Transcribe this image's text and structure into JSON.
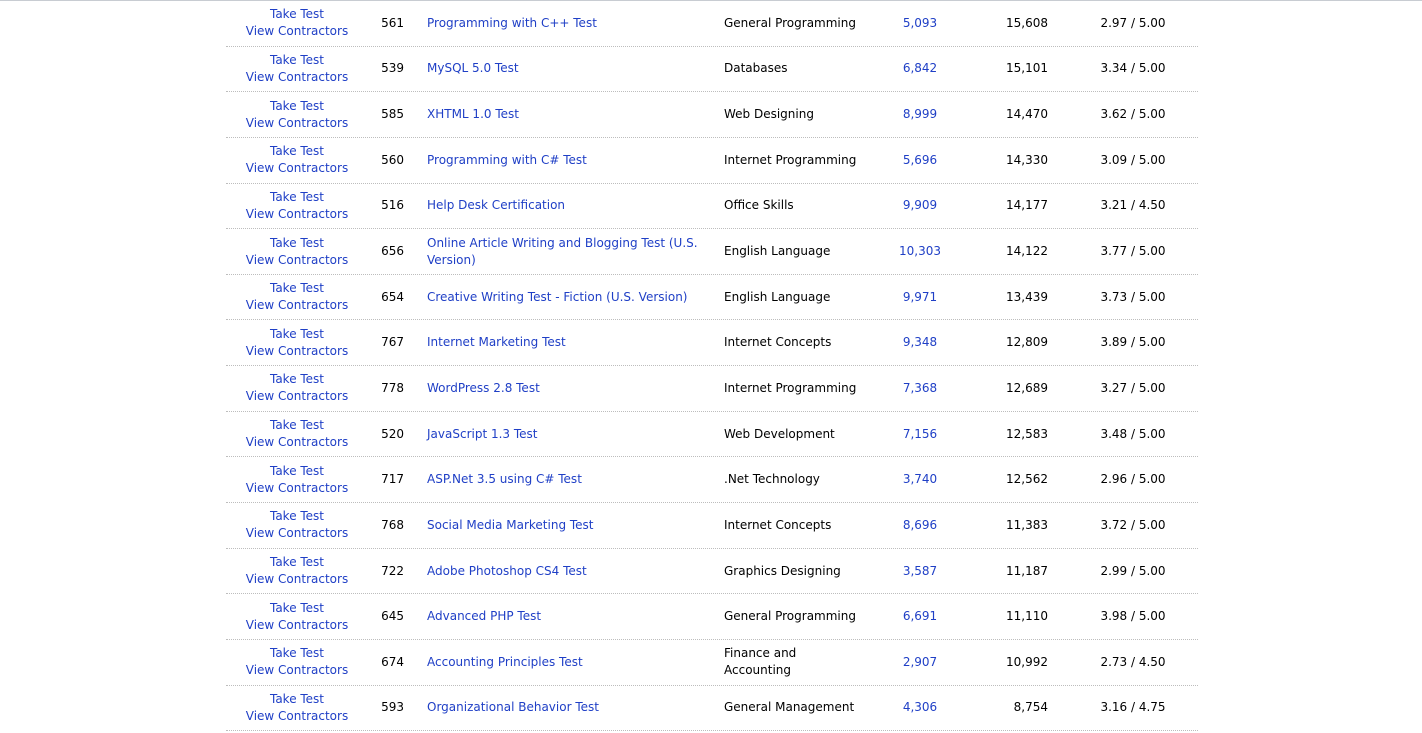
{
  "rows": [
    {
      "take_test": "Take Test",
      "view_contractors": "View Contractors",
      "id": "561",
      "name": "Programming with C++ Test",
      "category": "General Programming",
      "taken": "5,093",
      "passed": "15,608",
      "score": "2.97 / 5.00"
    },
    {
      "take_test": "Take Test",
      "view_contractors": "View Contractors",
      "id": "539",
      "name": "MySQL 5.0 Test",
      "category": "Databases",
      "taken": "6,842",
      "passed": "15,101",
      "score": "3.34 / 5.00"
    },
    {
      "take_test": "Take Test",
      "view_contractors": "View Contractors",
      "id": "585",
      "name": "XHTML 1.0 Test",
      "category": "Web Designing",
      "taken": "8,999",
      "passed": "14,470",
      "score": "3.62 / 5.00"
    },
    {
      "take_test": "Take Test",
      "view_contractors": "View Contractors",
      "id": "560",
      "name": "Programming with C# Test",
      "category": "Internet Programming",
      "taken": "5,696",
      "passed": "14,330",
      "score": "3.09 / 5.00"
    },
    {
      "take_test": "Take Test",
      "view_contractors": "View Contractors",
      "id": "516",
      "name": "Help Desk Certification",
      "category": "Office Skills",
      "taken": "9,909",
      "passed": "14,177",
      "score": "3.21 / 4.50"
    },
    {
      "take_test": "Take Test",
      "view_contractors": "View Contractors",
      "id": "656",
      "name": "Online Article Writing and Blogging Test (U.S. Version)",
      "category": "English Language",
      "taken": "10,303",
      "passed": "14,122",
      "score": "3.77 / 5.00"
    },
    {
      "take_test": "Take Test",
      "view_contractors": "View Contractors",
      "id": "654",
      "name": "Creative Writing Test - Fiction (U.S. Version)",
      "category": "English Language",
      "taken": "9,971",
      "passed": "13,439",
      "score": "3.73 / 5.00"
    },
    {
      "take_test": "Take Test",
      "view_contractors": "View Contractors",
      "id": "767",
      "name": "Internet Marketing Test",
      "category": "Internet Concepts",
      "taken": "9,348",
      "passed": "12,809",
      "score": "3.89 / 5.00"
    },
    {
      "take_test": "Take Test",
      "view_contractors": "View Contractors",
      "id": "778",
      "name": "WordPress 2.8 Test",
      "category": "Internet Programming",
      "taken": "7,368",
      "passed": "12,689",
      "score": "3.27 / 5.00"
    },
    {
      "take_test": "Take Test",
      "view_contractors": "View Contractors",
      "id": "520",
      "name": "JavaScript 1.3 Test",
      "category": "Web Development",
      "taken": "7,156",
      "passed": "12,583",
      "score": "3.48 / 5.00"
    },
    {
      "take_test": "Take Test",
      "view_contractors": "View Contractors",
      "id": "717",
      "name": "ASP.Net 3.5 using C# Test",
      "category": ".Net Technology",
      "taken": "3,740",
      "passed": "12,562",
      "score": "2.96 / 5.00"
    },
    {
      "take_test": "Take Test",
      "view_contractors": "View Contractors",
      "id": "768",
      "name": "Social Media Marketing Test",
      "category": "Internet Concepts",
      "taken": "8,696",
      "passed": "11,383",
      "score": "3.72 / 5.00"
    },
    {
      "take_test": "Take Test",
      "view_contractors": "View Contractors",
      "id": "722",
      "name": "Adobe Photoshop CS4 Test",
      "category": "Graphics Designing",
      "taken": "3,587",
      "passed": "11,187",
      "score": "2.99 / 5.00"
    },
    {
      "take_test": "Take Test",
      "view_contractors": "View Contractors",
      "id": "645",
      "name": "Advanced PHP Test",
      "category": "General Programming",
      "taken": "6,691",
      "passed": "11,110",
      "score": "3.98 / 5.00"
    },
    {
      "take_test": "Take Test",
      "view_contractors": "View Contractors",
      "id": "674",
      "name": "Accounting Principles Test",
      "category": "Finance and Accounting",
      "taken": "2,907",
      "passed": "10,992",
      "score": "2.73 / 4.50"
    },
    {
      "take_test": "Take Test",
      "view_contractors": "View Contractors",
      "id": "593",
      "name": "Organizational Behavior Test",
      "category": "General Management",
      "taken": "4,306",
      "passed": "8,754",
      "score": "3.16 / 4.75"
    }
  ]
}
